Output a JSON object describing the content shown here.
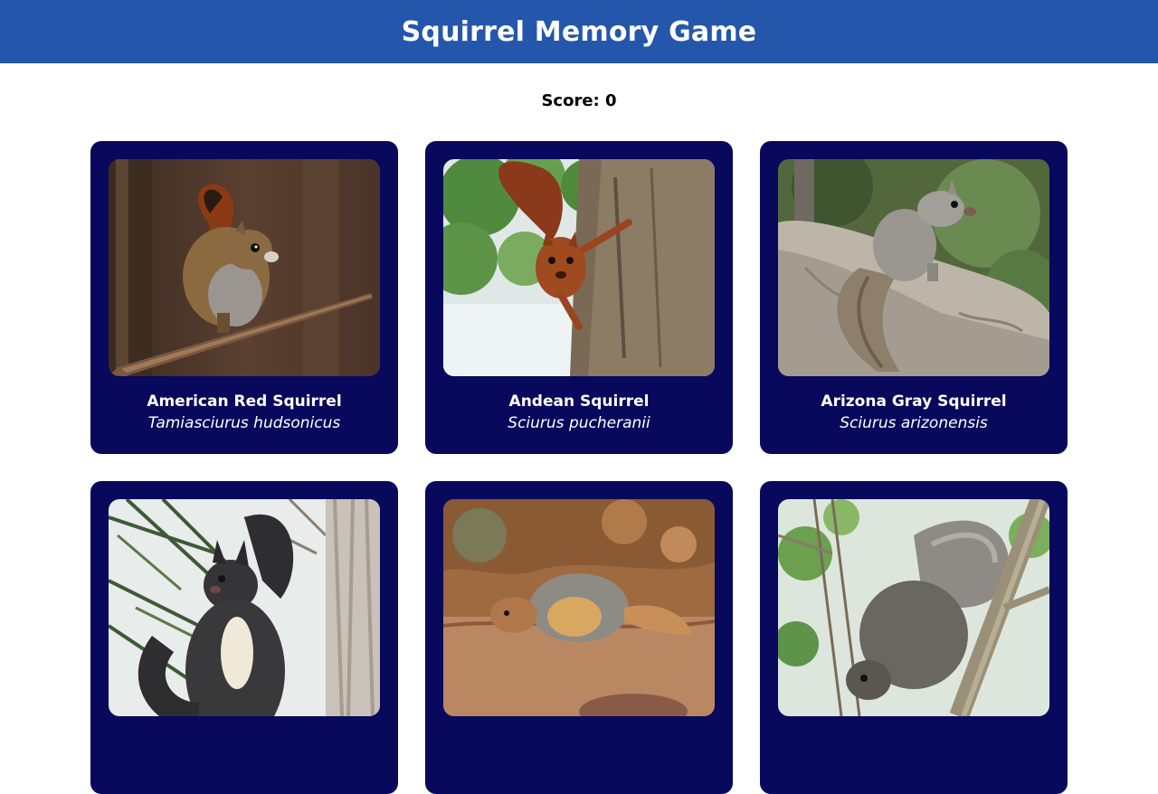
{
  "header": {
    "title": "Squirrel Memory Game"
  },
  "score": {
    "text": "Score: 0"
  },
  "cards": [
    {
      "name": "American Red Squirrel",
      "scientific": "Tamiasciurus hudsonicus"
    },
    {
      "name": "Andean Squirrel",
      "scientific": "Sciurus pucheranii"
    },
    {
      "name": "Arizona Gray Squirrel",
      "scientific": "Sciurus arizonensis"
    },
    {
      "name": "",
      "scientific": ""
    },
    {
      "name": "",
      "scientific": ""
    },
    {
      "name": "",
      "scientific": ""
    }
  ],
  "colors": {
    "header_bg": "#2457ab",
    "card_bg": "#08085c",
    "page_bg": "#ffffff"
  }
}
